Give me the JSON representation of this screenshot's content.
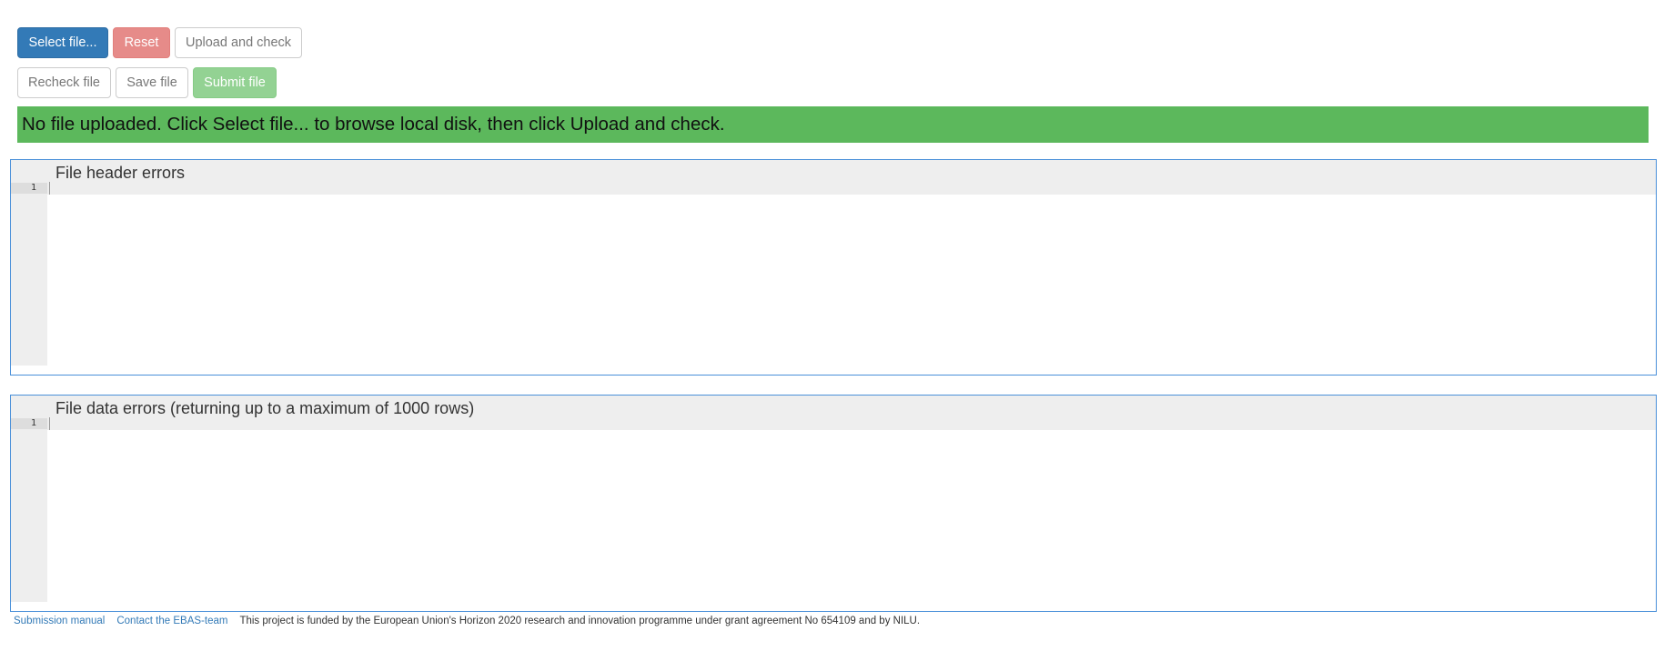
{
  "toolbar": {
    "select_file": "Select file...",
    "reset": "Reset",
    "upload_and_check": "Upload and check",
    "recheck_file": "Recheck file",
    "save_file": "Save file",
    "submit_file": "Submit file"
  },
  "status": {
    "message": "No file uploaded. Click Select file... to browse local disk, then click Upload and check."
  },
  "header_errors": {
    "title": "File header errors",
    "line_number": "1"
  },
  "data_errors": {
    "title": "File data errors (returning up to a maximum of 1000 rows)",
    "line_number": "1"
  },
  "footer": {
    "submission_manual": "Submission manual",
    "contact": "Contact the EBAS-team",
    "funding_note": "This project is funded by the European Union's Horizon 2020 research and innovation programme under grant agreement No 654109 and by NILU."
  },
  "colors": {
    "primary": "#337ab7",
    "danger_disabled": "#e68b89",
    "success": "#5cb85c",
    "success_disabled": "#93d293",
    "panel_border": "#4a90d9"
  }
}
